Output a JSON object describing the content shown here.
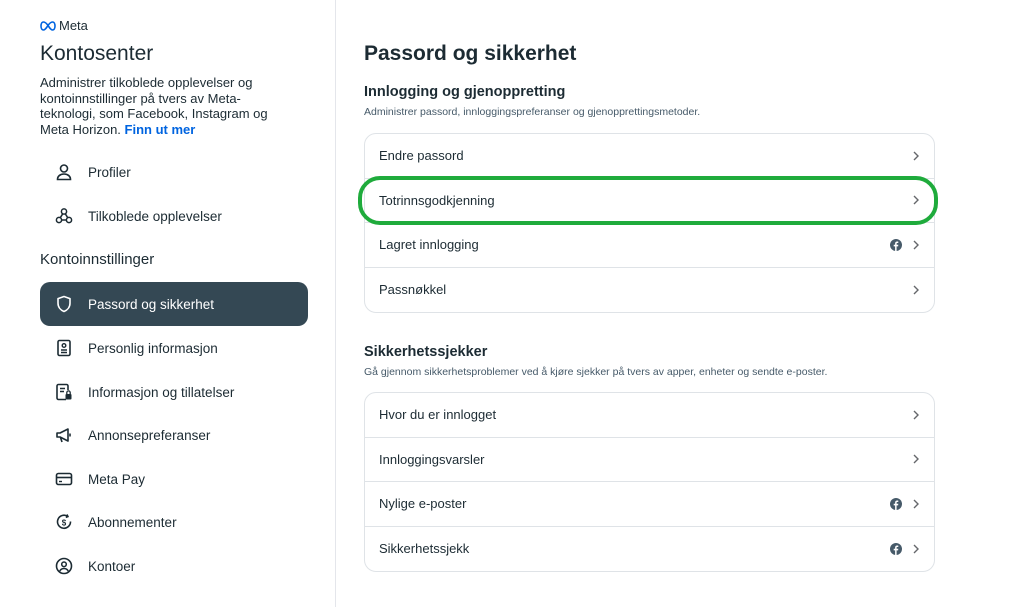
{
  "brand": {
    "logo_text": "Meta"
  },
  "sidebar": {
    "title": "Kontosenter",
    "description": "Administrer tilkoblede opplevelser og kontoinnstillinger på tvers av Meta-teknologi, som Facebook, Instagram og Meta Horizon.",
    "learn_more": "Finn ut mer",
    "top_items": [
      {
        "label": "Profiler",
        "icon": "person-icon"
      },
      {
        "label": "Tilkoblede opplevelser",
        "icon": "connected-icon"
      }
    ],
    "section_heading": "Kontoinnstillinger",
    "settings_items": [
      {
        "label": "Passord og sikkerhet",
        "icon": "shield-icon",
        "active": true
      },
      {
        "label": "Personlig informasjon",
        "icon": "id-card-icon"
      },
      {
        "label": "Informasjon og tillatelser",
        "icon": "document-lock-icon"
      },
      {
        "label": "Annonsepreferanser",
        "icon": "megaphone-icon"
      },
      {
        "label": "Meta Pay",
        "icon": "credit-card-icon"
      },
      {
        "label": "Abonnementer",
        "icon": "subscription-icon"
      },
      {
        "label": "Kontoer",
        "icon": "account-circle-icon"
      }
    ]
  },
  "main": {
    "title": "Passord og sikkerhet",
    "login_section": {
      "title": "Innlogging og gjenoppretting",
      "subtitle": "Administrer passord, innloggingspreferanser og gjenopprettingsmetoder.",
      "rows": [
        {
          "label": "Endre passord",
          "facebook_icon": false
        },
        {
          "label": "Totrinnsgodkjenning",
          "facebook_icon": false
        },
        {
          "label": "Lagret innlogging",
          "facebook_icon": true
        },
        {
          "label": "Passnøkkel",
          "facebook_icon": false
        }
      ]
    },
    "security_section": {
      "title": "Sikkerhetssjekker",
      "subtitle": "Gå gjennom sikkerhetsproblemer ved å kjøre sjekker på tvers av apper, enheter og sendte e-poster.",
      "rows": [
        {
          "label": "Hvor du er innlogget",
          "facebook_icon": false
        },
        {
          "label": "Innloggingsvarsler",
          "facebook_icon": false
        },
        {
          "label": "Nylige e-poster",
          "facebook_icon": true
        },
        {
          "label": "Sikkerhetssjekk",
          "facebook_icon": true
        }
      ]
    }
  },
  "colors": {
    "active_nav_bg": "#344854",
    "link": "#0064e0",
    "highlight_outline": "#1fab3c"
  }
}
